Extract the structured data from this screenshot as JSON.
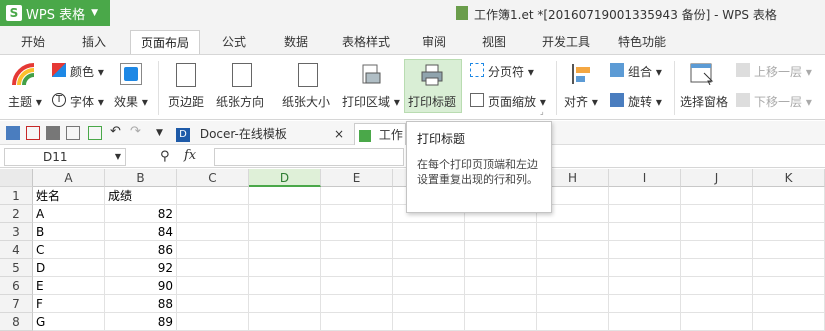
{
  "app": {
    "name": "WPS 表格",
    "logo": "S"
  },
  "window": {
    "title": "工作簿1.et *[20160719001335943 备份] - WPS 表格"
  },
  "tabs": [
    {
      "label": "开始"
    },
    {
      "label": "插入"
    },
    {
      "label": "页面布局",
      "active": true
    },
    {
      "label": "公式"
    },
    {
      "label": "数据"
    },
    {
      "label": "表格样式"
    },
    {
      "label": "审阅"
    },
    {
      "label": "视图"
    },
    {
      "label": "开发工具"
    },
    {
      "label": "特色功能"
    }
  ],
  "ribbon": {
    "theme": "主题",
    "color": "颜色",
    "font": "字体",
    "effect": "效果",
    "margin": "页边距",
    "orientation": "纸张方向",
    "size": "纸张大小",
    "print_area": "打印区域",
    "print_titles": "打印标题",
    "page_break": "分页符",
    "page_scale": "页面缩放",
    "align": "对齐",
    "group": "组合",
    "rotate": "旋转",
    "selection_pane": "选择窗格",
    "bring_forward": "上移一层",
    "send_backward": "下移一层"
  },
  "doc_tabs": [
    {
      "label": "Docer-在线模板"
    },
    {
      "label": "工作簿"
    }
  ],
  "formula_bar": {
    "name_box": "D11",
    "fx": "fx",
    "formula": ""
  },
  "tooltip": {
    "title": "打印标题",
    "body": "在每个打印页顶端和左边设置重复出现的行和列。"
  },
  "columns": [
    "A",
    "B",
    "C",
    "D",
    "E",
    "F",
    "G",
    "H",
    "I",
    "J",
    "K"
  ],
  "rows": [
    {
      "num": "1",
      "a": "姓名",
      "b": "成绩"
    },
    {
      "num": "2",
      "a": "A",
      "b": "82"
    },
    {
      "num": "3",
      "a": "B",
      "b": "84"
    },
    {
      "num": "4",
      "a": "C",
      "b": "86"
    },
    {
      "num": "5",
      "a": "D",
      "b": "92"
    },
    {
      "num": "6",
      "a": "E",
      "b": "90"
    },
    {
      "num": "7",
      "a": "F",
      "b": "88"
    },
    {
      "num": "8",
      "a": "G",
      "b": "89"
    }
  ],
  "colors": {
    "accent": "#4aa849",
    "selected_col": "#dff0d8"
  }
}
